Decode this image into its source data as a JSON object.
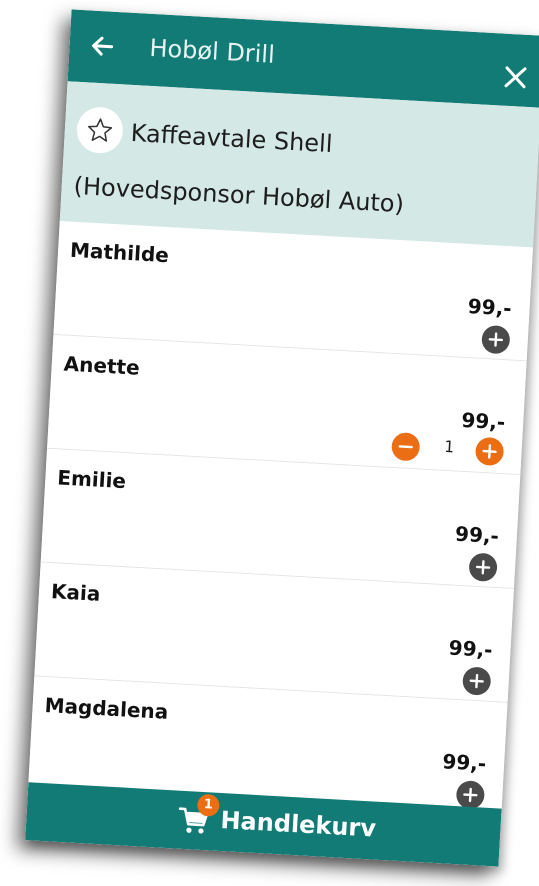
{
  "appbar": {
    "title": "Hobøl Drill"
  },
  "product": {
    "name": "Kaffeavtale Shell",
    "subtitle": "(Hovedsponsor Hobøl Auto)"
  },
  "rows": [
    {
      "name": "Mathilde",
      "price": "99,-"
    },
    {
      "name": "Anette",
      "price": "99,-",
      "quantity": "1"
    },
    {
      "name": "Emilie",
      "price": "99,-"
    },
    {
      "name": "Kaia",
      "price": "99,-"
    },
    {
      "name": "Magdalena",
      "price": "99,-"
    }
  ],
  "cart": {
    "label": "Handlekurv",
    "count": "1"
  },
  "colors": {
    "primary": "#137b75",
    "header_bg": "#d4e8e6",
    "accent": "#ec6e14",
    "button_dark": "#4a4a4a"
  },
  "icons": {
    "back": "arrow-left-icon",
    "close": "close-icon",
    "favorite": "star-outline-icon",
    "add": "plus-icon",
    "remove": "minus-icon",
    "cart": "cart-icon"
  }
}
